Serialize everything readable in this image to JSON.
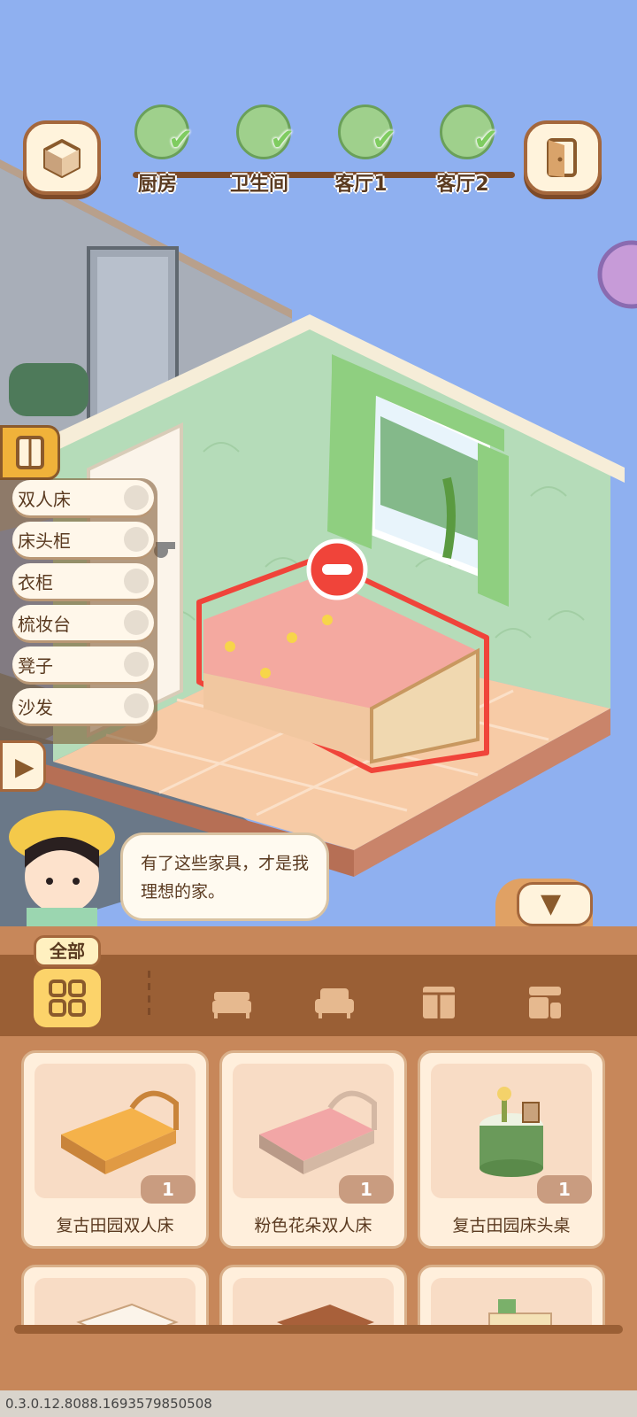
{
  "rooms": [
    {
      "label": "厨房",
      "completed": true
    },
    {
      "label": "卫生间",
      "completed": true
    },
    {
      "label": "客厅1",
      "completed": true
    },
    {
      "label": "客厅2",
      "completed": true
    }
  ],
  "icons": {
    "view_cube": "cube-icon",
    "exit": "door-icon",
    "remove": "minus-circle-icon",
    "check": "✔",
    "expand": "▶",
    "collapse": "▼"
  },
  "furniture_list": [
    {
      "label": "双人床"
    },
    {
      "label": "床头柜"
    },
    {
      "label": "衣柜"
    },
    {
      "label": "梳妆台"
    },
    {
      "label": "凳子"
    },
    {
      "label": "沙发"
    }
  ],
  "speech": "有了这些家具，才是我理想的家。",
  "tabs": {
    "all_label": "全部"
  },
  "items": [
    {
      "name": "复古田园双人床",
      "count": "1"
    },
    {
      "name": "粉色花朵双人床",
      "count": "1"
    },
    {
      "name": "复古田园床头桌",
      "count": "1"
    },
    {
      "name": "",
      "count": ""
    },
    {
      "name": "",
      "count": ""
    },
    {
      "name": "",
      "count": ""
    }
  ],
  "version": "0.3.0.12.8088.1693579850508",
  "colors": {
    "sky": "#8fb0f0",
    "panel": "#c7875a",
    "accent": "#f0b23a",
    "wall": "#bfe0c0",
    "floor": "#f7cba6",
    "selection": "#f0443a"
  }
}
